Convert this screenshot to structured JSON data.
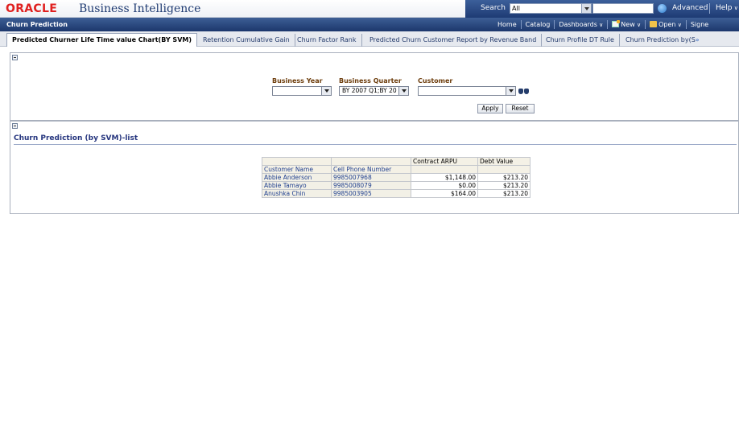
{
  "brand": {
    "oracle": "ORACLE",
    "product": "Business Intelligence"
  },
  "search": {
    "label": "Search",
    "scope": "All",
    "value": ""
  },
  "header_links": {
    "advanced": "Advanced",
    "help": "Help"
  },
  "dashboard": {
    "title": "Churn Prediction",
    "nav": [
      "Home",
      "Catalog",
      "Dashboards",
      "New",
      "Open",
      "Signe"
    ]
  },
  "tabs": [
    "Predicted Churner Life Time value Chart(BY SVM)",
    "Retention Cumulative Gain",
    "Churn Factor Rank",
    "Predicted Churn Customer Report by Revenue Band",
    "Churn Profile DT Rule",
    "Churn Prediction by(S"
  ],
  "tab_more": "»",
  "prompts": {
    "business_year": {
      "label": "Business Year",
      "value": ""
    },
    "business_quarter": {
      "label": "Business Quarter",
      "value": "BY 2007 Q1;BY 20"
    },
    "customer": {
      "label": "Customer",
      "value": ""
    },
    "apply": "Apply",
    "reset": "Reset"
  },
  "report": {
    "title": "Churn Prediction (by SVM)-list",
    "columns": [
      "Customer Name",
      "Cell Phone Number",
      "Contract ARPU",
      "Debt Value"
    ],
    "rows": [
      [
        "Abbie Anderson",
        "9985007968",
        "$1,148.00",
        "$213.20"
      ],
      [
        "Abbie Tamayo",
        "9985008079",
        "$0.00",
        "$213.20"
      ],
      [
        "Anushka Chin",
        "9985003905",
        "$164.00",
        "$213.20"
      ]
    ]
  }
}
